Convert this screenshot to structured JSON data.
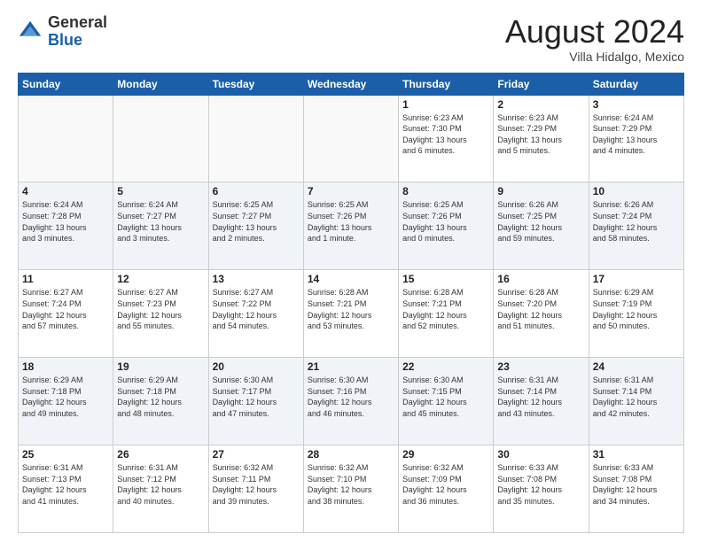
{
  "header": {
    "logo_general": "General",
    "logo_blue": "Blue",
    "month_title": "August 2024",
    "location": "Villa Hidalgo, Mexico"
  },
  "days_of_week": [
    "Sunday",
    "Monday",
    "Tuesday",
    "Wednesday",
    "Thursday",
    "Friday",
    "Saturday"
  ],
  "weeks": [
    [
      {
        "day": "",
        "info": ""
      },
      {
        "day": "",
        "info": ""
      },
      {
        "day": "",
        "info": ""
      },
      {
        "day": "",
        "info": ""
      },
      {
        "day": "1",
        "info": "Sunrise: 6:23 AM\nSunset: 7:30 PM\nDaylight: 13 hours\nand 6 minutes."
      },
      {
        "day": "2",
        "info": "Sunrise: 6:23 AM\nSunset: 7:29 PM\nDaylight: 13 hours\nand 5 minutes."
      },
      {
        "day": "3",
        "info": "Sunrise: 6:24 AM\nSunset: 7:29 PM\nDaylight: 13 hours\nand 4 minutes."
      }
    ],
    [
      {
        "day": "4",
        "info": "Sunrise: 6:24 AM\nSunset: 7:28 PM\nDaylight: 13 hours\nand 3 minutes."
      },
      {
        "day": "5",
        "info": "Sunrise: 6:24 AM\nSunset: 7:27 PM\nDaylight: 13 hours\nand 3 minutes."
      },
      {
        "day": "6",
        "info": "Sunrise: 6:25 AM\nSunset: 7:27 PM\nDaylight: 13 hours\nand 2 minutes."
      },
      {
        "day": "7",
        "info": "Sunrise: 6:25 AM\nSunset: 7:26 PM\nDaylight: 13 hours\nand 1 minute."
      },
      {
        "day": "8",
        "info": "Sunrise: 6:25 AM\nSunset: 7:26 PM\nDaylight: 13 hours\nand 0 minutes."
      },
      {
        "day": "9",
        "info": "Sunrise: 6:26 AM\nSunset: 7:25 PM\nDaylight: 12 hours\nand 59 minutes."
      },
      {
        "day": "10",
        "info": "Sunrise: 6:26 AM\nSunset: 7:24 PM\nDaylight: 12 hours\nand 58 minutes."
      }
    ],
    [
      {
        "day": "11",
        "info": "Sunrise: 6:27 AM\nSunset: 7:24 PM\nDaylight: 12 hours\nand 57 minutes."
      },
      {
        "day": "12",
        "info": "Sunrise: 6:27 AM\nSunset: 7:23 PM\nDaylight: 12 hours\nand 55 minutes."
      },
      {
        "day": "13",
        "info": "Sunrise: 6:27 AM\nSunset: 7:22 PM\nDaylight: 12 hours\nand 54 minutes."
      },
      {
        "day": "14",
        "info": "Sunrise: 6:28 AM\nSunset: 7:21 PM\nDaylight: 12 hours\nand 53 minutes."
      },
      {
        "day": "15",
        "info": "Sunrise: 6:28 AM\nSunset: 7:21 PM\nDaylight: 12 hours\nand 52 minutes."
      },
      {
        "day": "16",
        "info": "Sunrise: 6:28 AM\nSunset: 7:20 PM\nDaylight: 12 hours\nand 51 minutes."
      },
      {
        "day": "17",
        "info": "Sunrise: 6:29 AM\nSunset: 7:19 PM\nDaylight: 12 hours\nand 50 minutes."
      }
    ],
    [
      {
        "day": "18",
        "info": "Sunrise: 6:29 AM\nSunset: 7:18 PM\nDaylight: 12 hours\nand 49 minutes."
      },
      {
        "day": "19",
        "info": "Sunrise: 6:29 AM\nSunset: 7:18 PM\nDaylight: 12 hours\nand 48 minutes."
      },
      {
        "day": "20",
        "info": "Sunrise: 6:30 AM\nSunset: 7:17 PM\nDaylight: 12 hours\nand 47 minutes."
      },
      {
        "day": "21",
        "info": "Sunrise: 6:30 AM\nSunset: 7:16 PM\nDaylight: 12 hours\nand 46 minutes."
      },
      {
        "day": "22",
        "info": "Sunrise: 6:30 AM\nSunset: 7:15 PM\nDaylight: 12 hours\nand 45 minutes."
      },
      {
        "day": "23",
        "info": "Sunrise: 6:31 AM\nSunset: 7:14 PM\nDaylight: 12 hours\nand 43 minutes."
      },
      {
        "day": "24",
        "info": "Sunrise: 6:31 AM\nSunset: 7:14 PM\nDaylight: 12 hours\nand 42 minutes."
      }
    ],
    [
      {
        "day": "25",
        "info": "Sunrise: 6:31 AM\nSunset: 7:13 PM\nDaylight: 12 hours\nand 41 minutes."
      },
      {
        "day": "26",
        "info": "Sunrise: 6:31 AM\nSunset: 7:12 PM\nDaylight: 12 hours\nand 40 minutes."
      },
      {
        "day": "27",
        "info": "Sunrise: 6:32 AM\nSunset: 7:11 PM\nDaylight: 12 hours\nand 39 minutes."
      },
      {
        "day": "28",
        "info": "Sunrise: 6:32 AM\nSunset: 7:10 PM\nDaylight: 12 hours\nand 38 minutes."
      },
      {
        "day": "29",
        "info": "Sunrise: 6:32 AM\nSunset: 7:09 PM\nDaylight: 12 hours\nand 36 minutes."
      },
      {
        "day": "30",
        "info": "Sunrise: 6:33 AM\nSunset: 7:08 PM\nDaylight: 12 hours\nand 35 minutes."
      },
      {
        "day": "31",
        "info": "Sunrise: 6:33 AM\nSunset: 7:08 PM\nDaylight: 12 hours\nand 34 minutes."
      }
    ]
  ]
}
